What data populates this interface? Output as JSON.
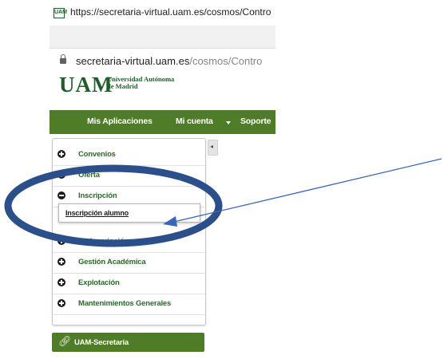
{
  "browser": {
    "address_bar_full": "https://secretaria-virtual.uam.es/cosmos/Contro",
    "favicon_text": "UAM",
    "address_domain": "secretaria-virtual.uam.es",
    "address_path": "/cosmos/Contro"
  },
  "logo": {
    "main": "UAM",
    "sub_line1": "Universidad Autónoma",
    "sub_line2": "de Madrid"
  },
  "nav": {
    "items": [
      "Mis Aplicaciones",
      "Mi cuenta",
      "Soporte"
    ]
  },
  "sidebar": {
    "items": [
      {
        "label": "Convenios",
        "icon": "plus-circle-icon"
      },
      {
        "label": "Oferta",
        "icon": "plus-circle-icon"
      },
      {
        "label": "Inscripción",
        "icon": "minus-circle-icon"
      },
      {
        "label": "Preinscripción",
        "icon": "plus-circle-icon"
      },
      {
        "label": "Gestión Académica",
        "icon": "plus-circle-icon"
      },
      {
        "label": "Explotación",
        "icon": "plus-circle-icon"
      },
      {
        "label": "Mantenimientos Generales",
        "icon": "plus-circle-icon"
      }
    ],
    "submenu_item": "Inscripción alumno",
    "footer_button": "UAM-Secretaría"
  },
  "annotation": {
    "ellipse_color": "#2b4f8a",
    "arrow_color": "#3a66b8"
  },
  "colors": {
    "brand_green": "#4f7d27",
    "text_green": "#2a6b2a"
  }
}
